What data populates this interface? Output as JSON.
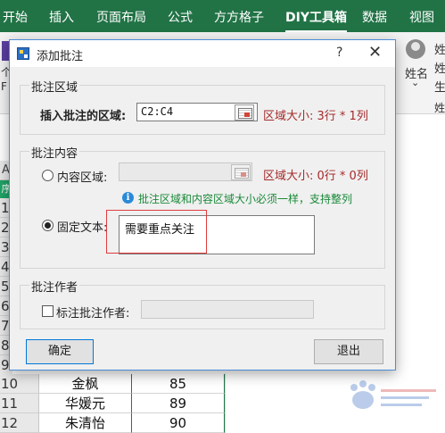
{
  "ribbon": {
    "tabs": [
      "开始",
      "插入",
      "页面布局",
      "公式",
      "方方格子",
      "DIY工具箱",
      "数据",
      "视图"
    ],
    "active_tab_index": 5,
    "right_text_top": "姓",
    "right_text_mid": "姓",
    "right_text_bot": "生",
    "group_label": "姓名",
    "left_edge_text": "个",
    "left_edge_text2": "F",
    "avatar_caret": "⌄",
    "right_bottom_edge": "姓"
  },
  "sheet": {
    "col_a": "A",
    "green_cell_text": "序",
    "row_numbers": [
      "1",
      "2",
      "3",
      "4",
      "5",
      "6",
      "7",
      "8",
      "9"
    ],
    "rows": [
      {
        "num": "10",
        "name": "金枫",
        "score": "85"
      },
      {
        "num": "11",
        "name": "华媛元",
        "score": "89"
      },
      {
        "num": "12",
        "name": "朱清怡",
        "score": "90"
      }
    ]
  },
  "dialog": {
    "title": "添加批注",
    "help_glyph": "?",
    "close_glyph": "✕",
    "region_group": {
      "title": "批注区域",
      "label": "插入批注的区域:",
      "value": "C2:C4",
      "size_text": "区域大小: 3行 * 1列"
    },
    "content_group": {
      "title": "批注内容",
      "radio_range_label": "内容区域:",
      "range_value": "",
      "range_size_text": "区域大小: 0行 * 0列",
      "info_text": "批注区域和内容区域大小必须一样，支持整列",
      "radio_fixed_label": "固定文本:",
      "fixed_text": "需要重点关注"
    },
    "author_group": {
      "title": "批注作者",
      "checkbox_label": "标注批注作者:",
      "author_value": ""
    },
    "ok_label": "确定",
    "exit_label": "退出"
  },
  "colors": {
    "ribbon": "#217346",
    "accent_red": "#a52a2a",
    "info_green": "#1a8a3a",
    "annotation_red": "#e03c3c"
  }
}
